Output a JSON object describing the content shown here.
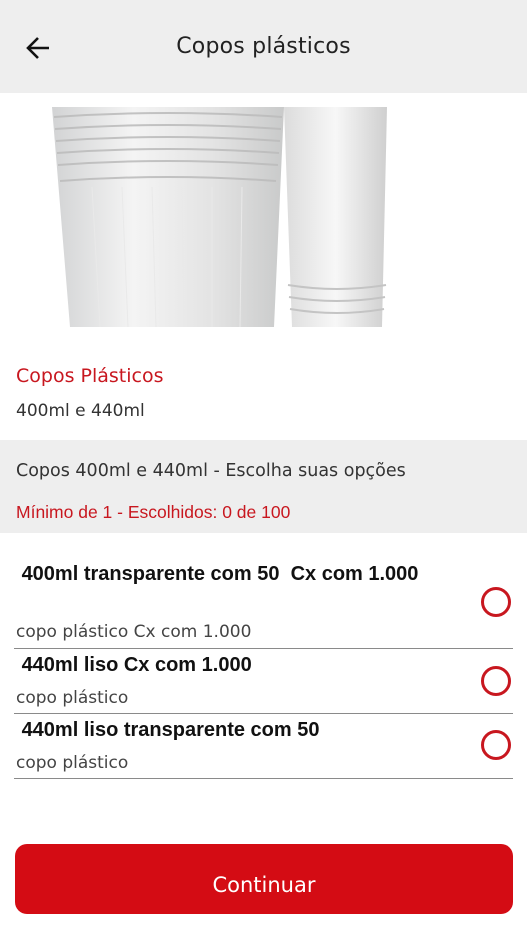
{
  "header": {
    "title": "Copos plásticos",
    "back_icon": "arrow-left-icon"
  },
  "product": {
    "image": "plastic-cups-image",
    "name": "Copos Plásticos",
    "description": "400ml e 440ml"
  },
  "options_section": {
    "title": "Copos 400ml e 440ml - Escolha suas opções",
    "rule": "Mínimo de 1 - Escolhidos: 0 de 100"
  },
  "options": [
    {
      "title": " 400ml transparente com 50  Cx com 1.000",
      "subtitle": "copo plástico Cx com 1.000",
      "selected": false
    },
    {
      "title": " 440ml liso Cx com 1.000",
      "subtitle": "copo plástico",
      "selected": false
    },
    {
      "title": " 440ml liso transparente com 50",
      "subtitle": "copo plástico",
      "selected": false
    }
  ],
  "continue_button": {
    "label": "Continuar"
  },
  "colors": {
    "accent": "#d40c14",
    "accent_text": "#c8171f",
    "header_bg": "#eeeeee"
  }
}
